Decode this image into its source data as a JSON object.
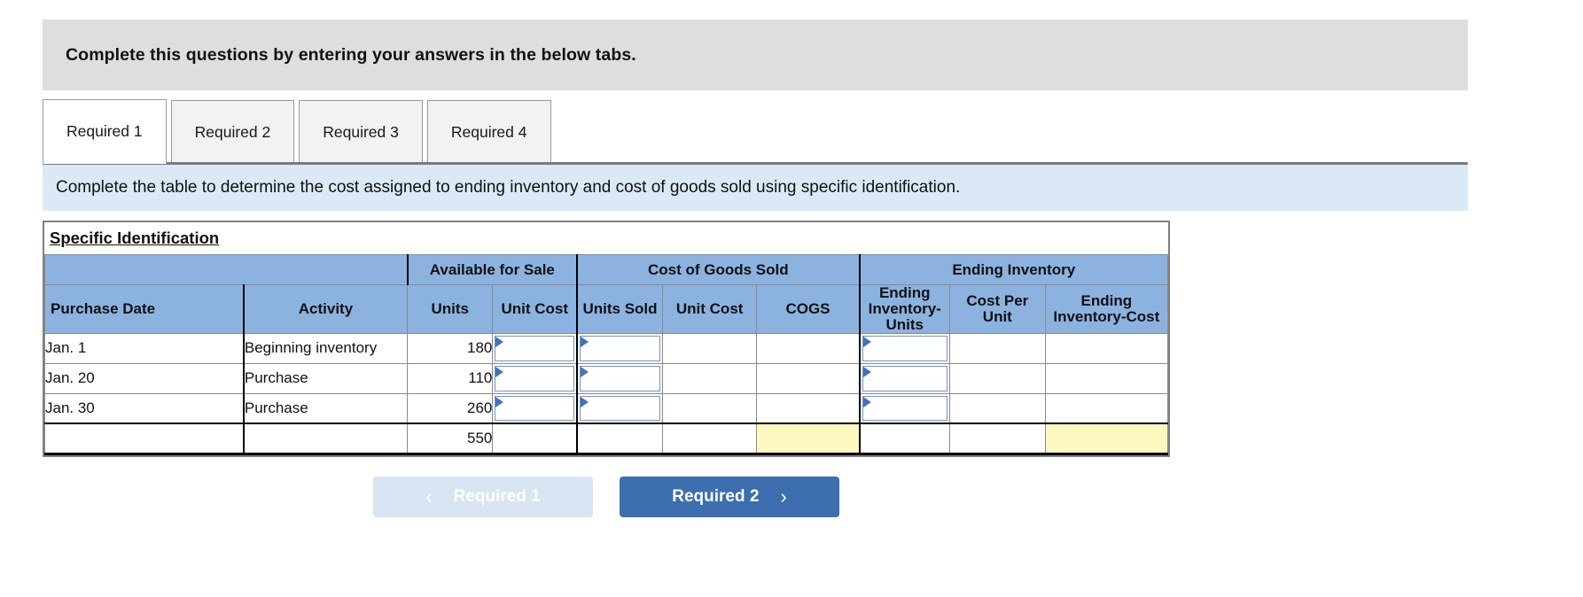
{
  "prompt": {
    "text": "Complete this questions by entering your answers in the below tabs."
  },
  "tabs": [
    {
      "label": "Required 1",
      "active": true
    },
    {
      "label": "Required 2",
      "active": false
    },
    {
      "label": "Required 3",
      "active": false
    },
    {
      "label": "Required 4",
      "active": false
    }
  ],
  "sub_instruction": {
    "text": "Complete the table to determine the cost assigned to ending inventory and cost of goods sold using specific identification."
  },
  "worksheet": {
    "title": "Specific Identification",
    "group_headers": [
      {
        "label": "",
        "span": 2
      },
      {
        "label": "Available for Sale",
        "span": 2
      },
      {
        "label": "Cost of Goods Sold",
        "span": 3
      },
      {
        "label": "Ending Inventory",
        "span": 3
      }
    ],
    "columns": [
      "Purchase Date",
      "Activity",
      "Units",
      "Unit Cost",
      "Units Sold",
      "Unit Cost",
      "COGS",
      "Ending Inventory-Units",
      "Cost Per Unit",
      "Ending Inventory-Cost"
    ],
    "rows": [
      {
        "purchase_date": "Jan. 1",
        "activity": "Beginning inventory",
        "units": "180",
        "unit_cost": "",
        "units_sold": "",
        "cogs_unit_cost": "",
        "cogs": "",
        "ending_units": "",
        "cost_per_unit": "",
        "ending_cost": ""
      },
      {
        "purchase_date": "Jan. 20",
        "activity": "Purchase",
        "units": "110",
        "unit_cost": "",
        "units_sold": "",
        "cogs_unit_cost": "",
        "cogs": "",
        "ending_units": "",
        "cost_per_unit": "",
        "ending_cost": ""
      },
      {
        "purchase_date": "Jan. 30",
        "activity": "Purchase",
        "units": "260",
        "unit_cost": "",
        "units_sold": "",
        "cogs_unit_cost": "",
        "cogs": "",
        "ending_units": "",
        "cost_per_unit": "",
        "ending_cost": ""
      }
    ],
    "total_row": {
      "purchase_date": "",
      "activity": "",
      "units": "550",
      "unit_cost": "",
      "units_sold": "",
      "cogs_unit_cost": "",
      "cogs": "",
      "ending_units": "",
      "cost_per_unit": "",
      "ending_cost": ""
    }
  },
  "nav": {
    "prev_label": "Required 1",
    "next_label": "Required 2",
    "prev_icon": "chevron-left-icon",
    "next_icon": "chevron-right-icon"
  },
  "colors": {
    "header_blue": "#8cb3e0",
    "banner_gray": "#dedede",
    "info_blue": "#dbe9f7",
    "highlight_yellow": "#fcf8bf",
    "button_blue": "#3c6eb0",
    "button_disabled": "#d8e4f2",
    "input_border": "#6f95c8",
    "marker_blue": "#4472b8"
  }
}
